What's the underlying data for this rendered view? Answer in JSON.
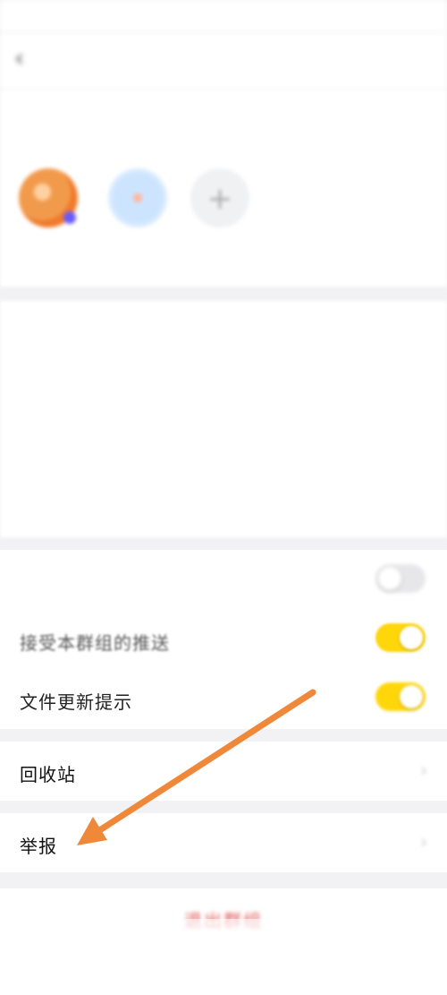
{
  "status": {
    "left": "",
    "right": ""
  },
  "nav": {
    "title": "",
    "back": "‹"
  },
  "members": {
    "label": "",
    "count": "",
    "items": [
      {
        "name": ""
      },
      {
        "name": ""
      },
      {
        "name": "",
        "plus": "+"
      }
    ]
  },
  "info": [
    {
      "label": "",
      "value": ""
    },
    {
      "label": "",
      "value": ""
    },
    {
      "label": "",
      "value": ""
    },
    {
      "label": "",
      "value": ""
    }
  ],
  "settings": [
    {
      "label": "",
      "toggle": "off"
    },
    {
      "label": "接受本群组的推送",
      "toggle": "on"
    },
    {
      "label": "文件更新提示",
      "toggle": "on"
    }
  ],
  "recycle": {
    "label": "回收站",
    "chevron": "›"
  },
  "report": {
    "label": "举报",
    "chevron": "›"
  },
  "exit": {
    "label": "退出群组"
  },
  "colors": {
    "toggle_on": "#ffd60a",
    "arrow": "#f0883a",
    "exit_text": "#e25a5a"
  }
}
